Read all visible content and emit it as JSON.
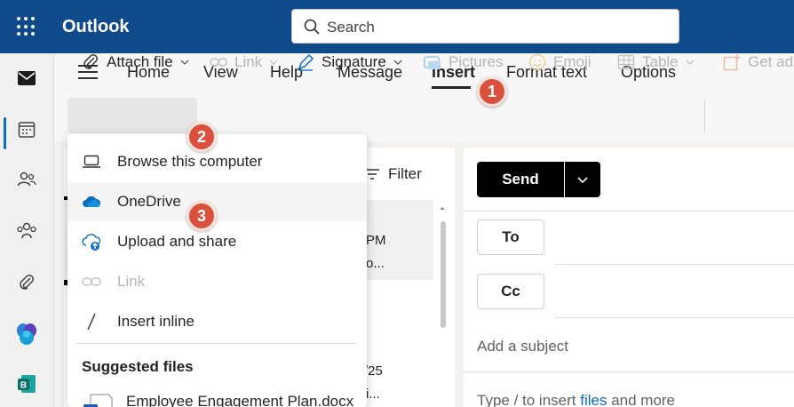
{
  "app": {
    "name": "Outlook"
  },
  "search": {
    "placeholder": "Search"
  },
  "nav_tabs": [
    {
      "label": "Home"
    },
    {
      "label": "View"
    },
    {
      "label": "Help"
    },
    {
      "label": "Message"
    },
    {
      "label": "Insert",
      "active": true
    },
    {
      "label": "Format text"
    },
    {
      "label": "Options"
    }
  ],
  "toolbar": {
    "attach_file": "Attach file",
    "link": "Link",
    "signature": "Signature",
    "pictures": "Pictures",
    "emoji": "Emoji",
    "table": "Table",
    "get_addins": "Get ad"
  },
  "attach_menu": {
    "items": [
      {
        "label": "Browse this computer",
        "icon": "laptop-icon"
      },
      {
        "label": "OneDrive",
        "icon": "onedrive-icon"
      },
      {
        "label": "Upload and share",
        "icon": "cloud-upload-icon"
      },
      {
        "label": "Link",
        "icon": "link-icon",
        "disabled": true
      },
      {
        "label": "Insert inline",
        "icon": "slash-icon"
      }
    ],
    "suggested_heading": "Suggested files",
    "suggested_files": [
      {
        "label": "Employee Engagement Plan.docx",
        "icon": "word-file-icon"
      }
    ]
  },
  "message_list": {
    "filter_label": "Filter",
    "partials": [
      "PM",
      "o...",
      "/25",
      "i..."
    ]
  },
  "compose": {
    "send": "Send",
    "to": "To",
    "cc": "Cc",
    "subject_placeholder": "Add a subject",
    "body_prefix": "Type / to insert ",
    "body_link": "files",
    "body_suffix": " and more"
  },
  "badges": [
    "1",
    "2",
    "3"
  ],
  "colors": {
    "topbar": "#0f4a8a",
    "badge": "#d9513c",
    "accent": "#0f6cbd",
    "send": "#000000"
  }
}
